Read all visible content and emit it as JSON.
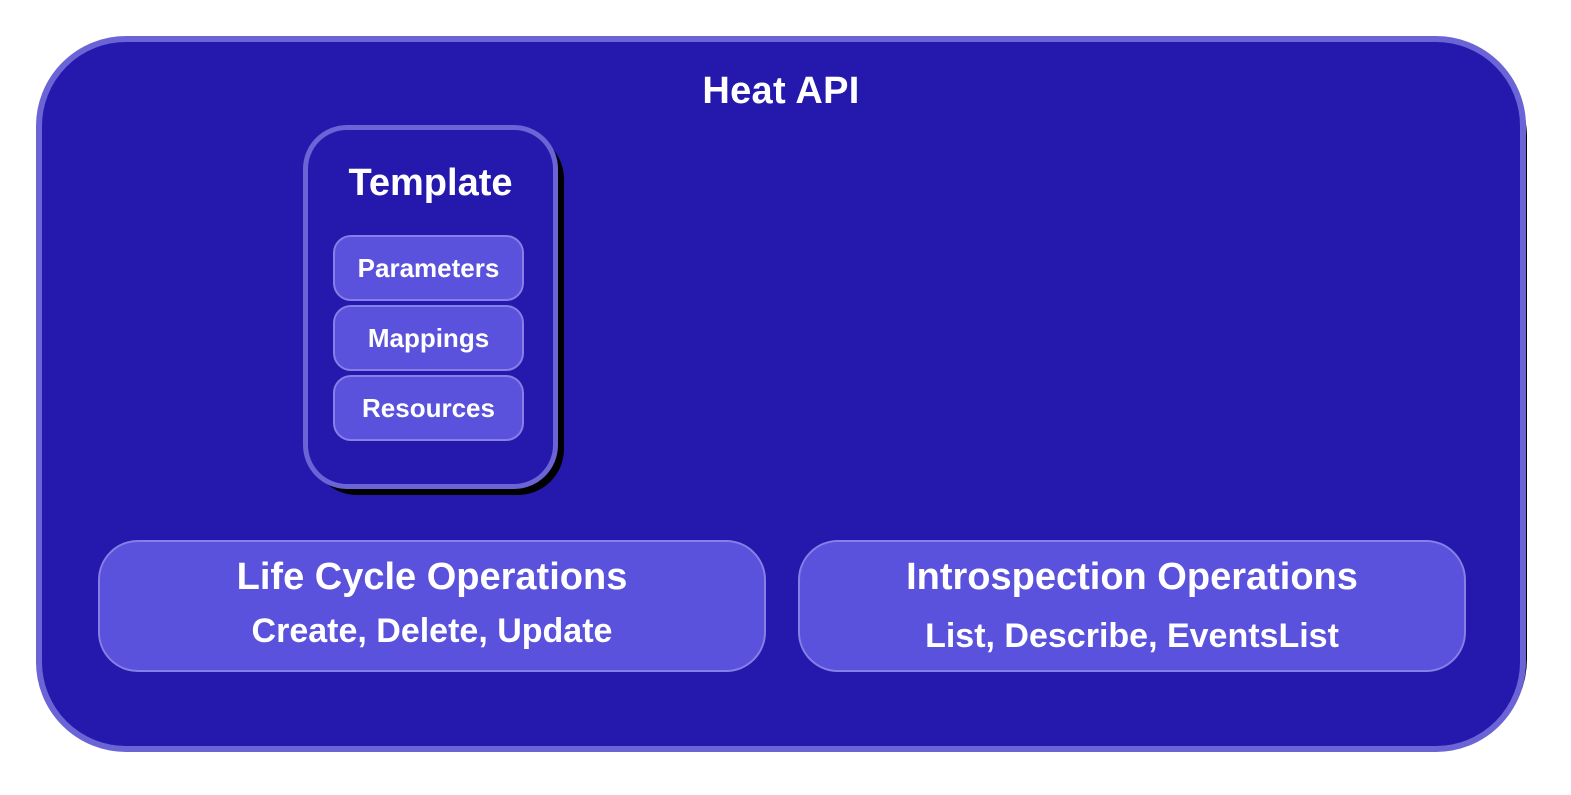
{
  "diagram": {
    "title": "Heat API",
    "template": {
      "title": "Template",
      "items": [
        "Parameters",
        "Mappings",
        "Resources"
      ]
    },
    "operations": [
      {
        "title": "Life Cycle Operations",
        "subtitle": "Create, Delete, Update"
      },
      {
        "title": "Introspection Operations",
        "subtitle": "List, Describe, EventsList"
      }
    ]
  },
  "colors": {
    "container_fill": "#2519ad",
    "container_border": "#6a64d6",
    "box_fill": "#5a51dd",
    "box_border": "#857fe6",
    "text": "#ffffff",
    "shadow": "#000000"
  }
}
